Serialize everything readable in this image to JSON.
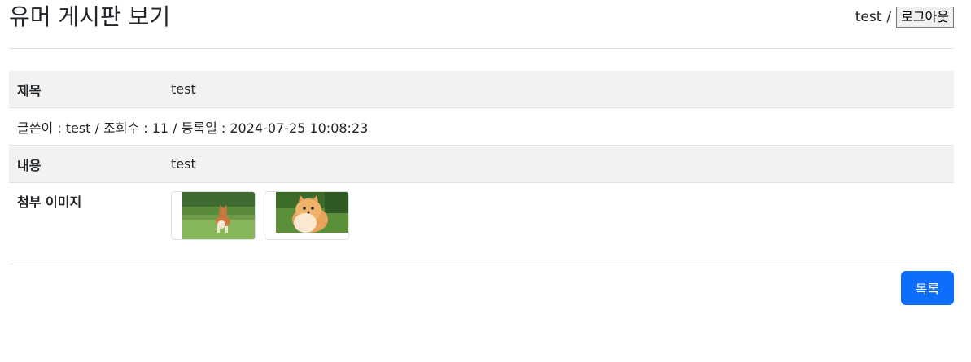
{
  "header": {
    "title": "유머 게시판 보기",
    "user_name": "test",
    "separator": "/",
    "logout_label": "로그아웃"
  },
  "post": {
    "title_label": "제목",
    "title_value": "test",
    "meta_line": "글쓴이 : test / 조회수 : 11 / 등록일 : 2024-07-25 10:08:23",
    "content_label": "내용",
    "content_value": "test",
    "attachments_label": "첨부 이미지",
    "attachments": [
      {
        "subject": "corgi dog running on grass"
      },
      {
        "subject": "pomeranian dog sitting on grass"
      }
    ]
  },
  "footer": {
    "list_label": "목록"
  },
  "colors": {
    "primary": "#0d6efd",
    "row_gray": "#f2f2f2",
    "border": "#dee2e6"
  }
}
